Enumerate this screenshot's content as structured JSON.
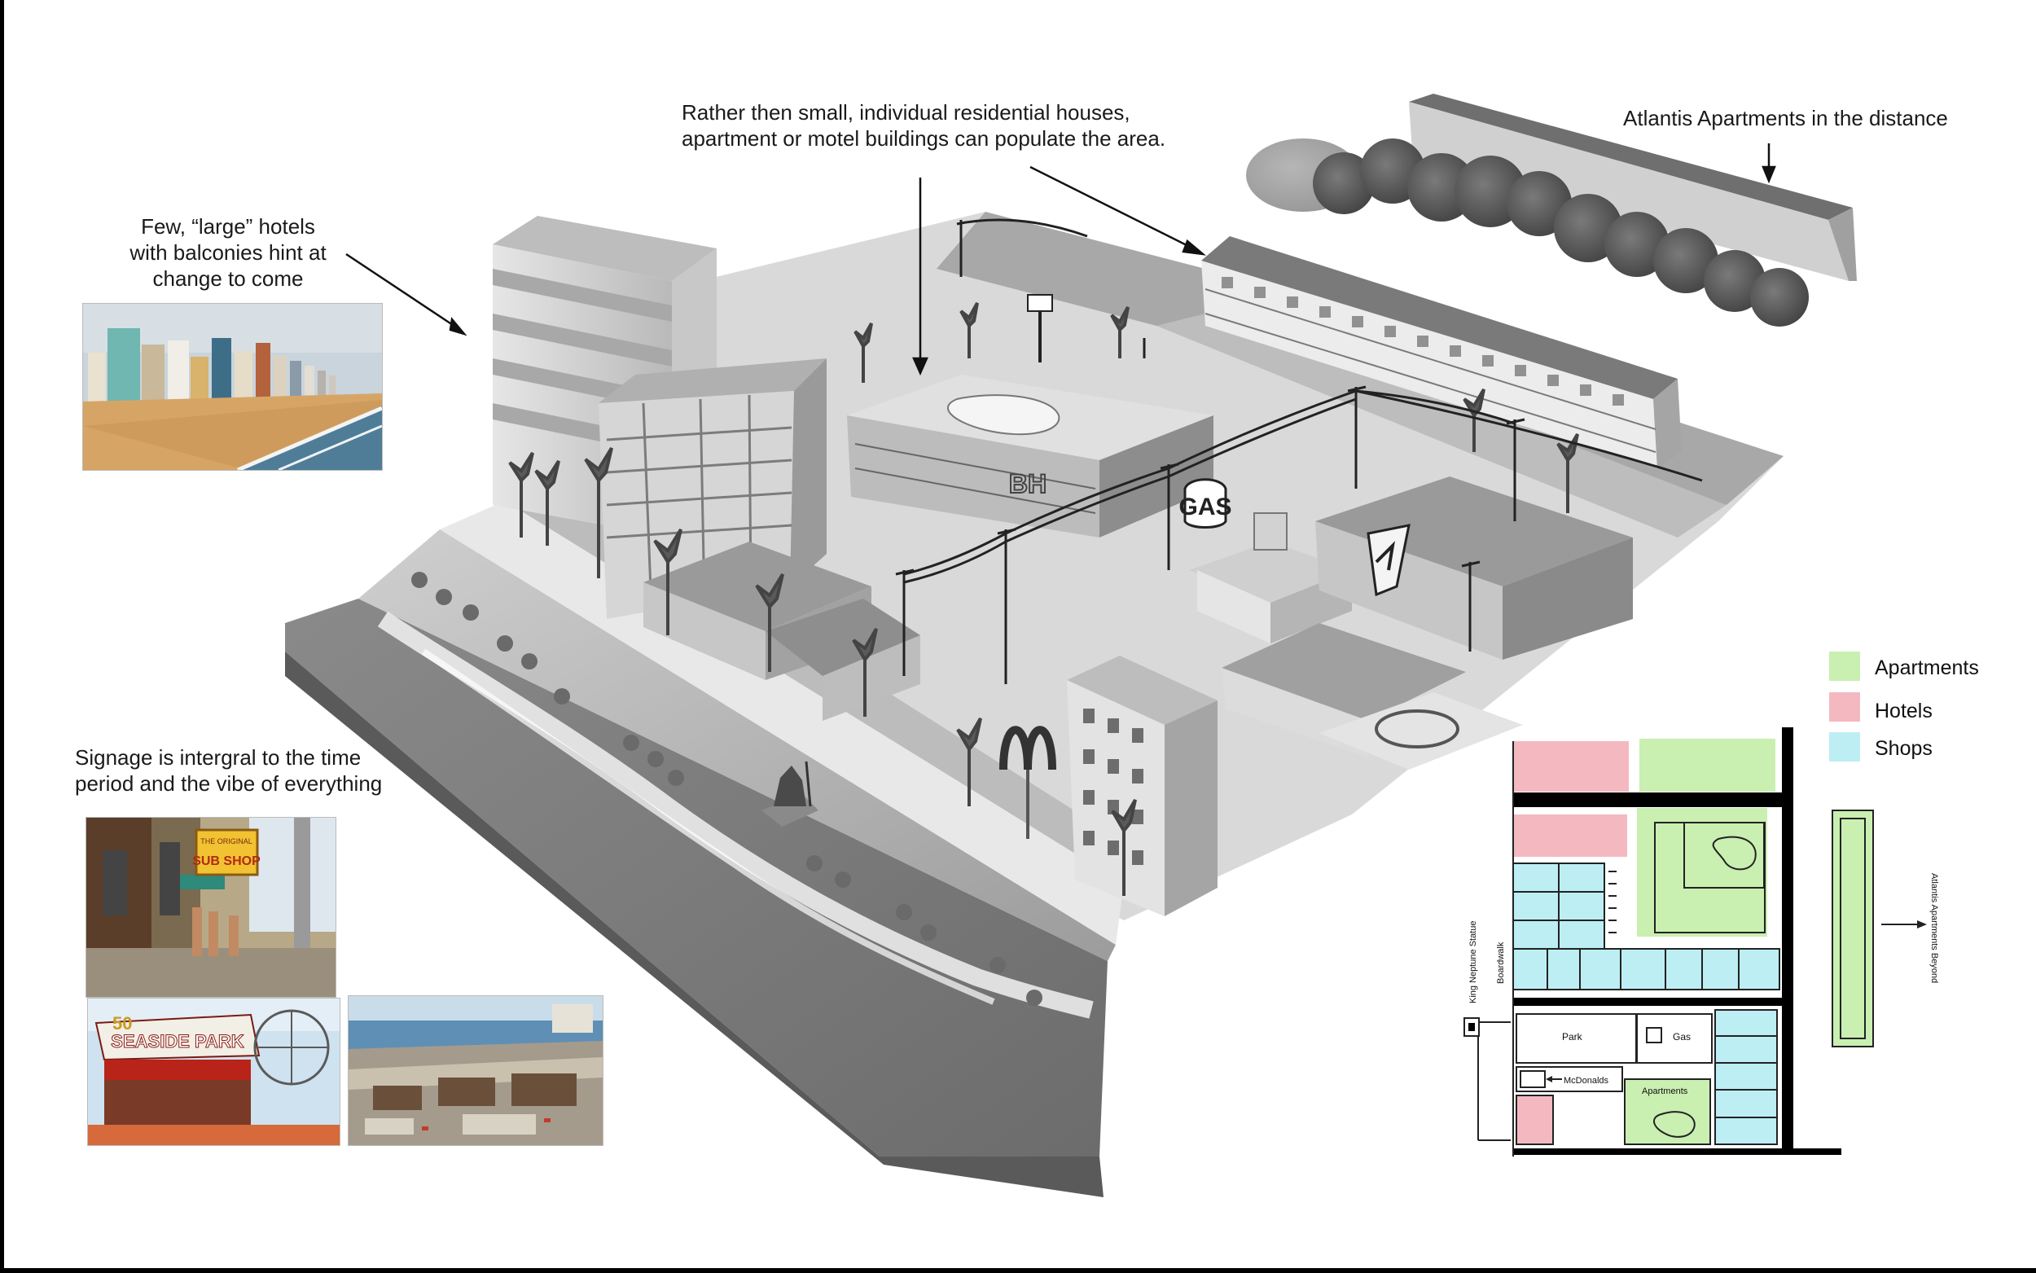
{
  "annotations": {
    "hotels_note": [
      "Few, “large” hotels",
      "with balconies hint at",
      "change to come"
    ],
    "residential_note": [
      "Rather then small, individual residential houses,",
      "apartment or motel buildings can populate the area."
    ],
    "atlantis_note": "Atlantis Apartments in the distance",
    "signage_note": [
      "Signage is intergral to the time",
      "period and the vibe of everything"
    ]
  },
  "photos": {
    "sign_text": "SUB SHOP",
    "sign_top": "THE ORIGINAL",
    "park_sign": "SEASIDE PARK",
    "park_number": "50"
  },
  "sketch_signs": {
    "gas": "GAS",
    "bh": "BH"
  },
  "legend": [
    {
      "label": "Apartments",
      "color": "#c9efb1"
    },
    {
      "label": "Hotels",
      "color": "#f4b9c0"
    },
    {
      "label": "Shops",
      "color": "#bdeef3"
    }
  ],
  "plan": {
    "labels": {
      "king_neptune": "King Neptune Statue",
      "boardwalk": "Boardwalk",
      "park": "Park",
      "gas": "Gas",
      "mcdonalds": "McDonalds",
      "apartments": "Apartments",
      "atlantis_beyond": "Atlantis Apartments Beyond"
    }
  }
}
